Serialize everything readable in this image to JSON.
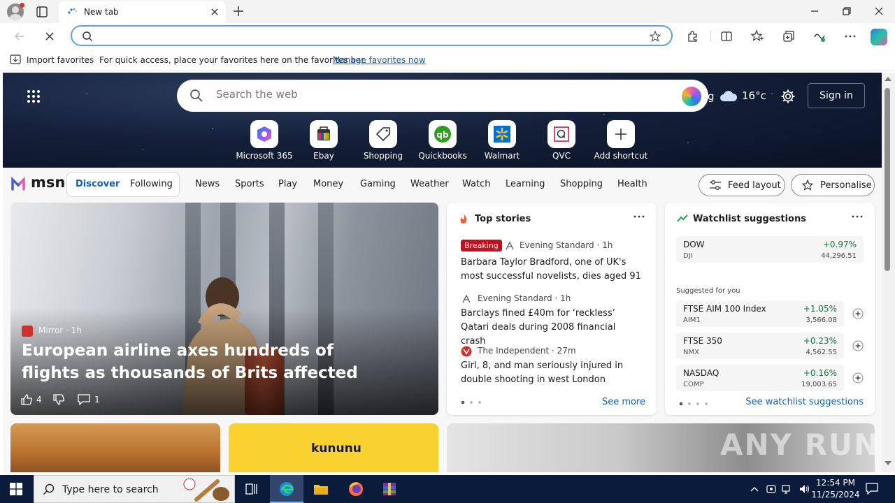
{
  "browser": {
    "tab_title": "New tab",
    "window_controls": [
      "minimize-icon",
      "restore-icon",
      "close-icon"
    ]
  },
  "toolbar": {
    "address_value": "",
    "icons": [
      "back-icon",
      "stop-loading-icon",
      "search-icon",
      "favorite-star-icon",
      "extensions-icon",
      "split-screen-icon",
      "favorites-icon",
      "collections-icon",
      "browser-essentials-icon",
      "more-icon",
      "copilot-icon"
    ]
  },
  "favbar": {
    "import_label": "Import favorites",
    "message": "For quick access, place your favorites here on the favorites bar.",
    "manage_link": "Manage favorites now"
  },
  "hero": {
    "search_placeholder": "Search the web",
    "bing_label": "g",
    "temperature": "16°c",
    "signin_label": "Sign in",
    "shortcuts": [
      {
        "label": "Microsoft 365",
        "icon": "microsoft-365-icon"
      },
      {
        "label": "Ebay",
        "icon": "ebay-icon"
      },
      {
        "label": "Shopping",
        "icon": "shopping-tag-icon"
      },
      {
        "label": "Quickbooks",
        "icon": "quickbooks-icon"
      },
      {
        "label": "Walmart",
        "icon": "walmart-icon"
      },
      {
        "label": "QVC",
        "icon": "qvc-icon"
      },
      {
        "label": "Add shortcut",
        "icon": "plus-icon"
      }
    ]
  },
  "msn": {
    "logo_text": "msn",
    "seg_discover": "Discover",
    "seg_following": "Following",
    "nav": [
      "News",
      "Sports",
      "Play",
      "Money",
      "Gaming",
      "Weather",
      "Watch",
      "Learning",
      "Shopping",
      "Health"
    ],
    "feed_layout_label": "Feed layout",
    "personalise_label": "Personalise"
  },
  "hero_story": {
    "source": "Mirror · 1h",
    "title": "European airline axes hundreds of flights as thousands of Brits affected",
    "likes": "4",
    "comments": "1"
  },
  "top_stories": {
    "title": "Top stories",
    "breaking_label": "Breaking",
    "items": [
      {
        "source": "Evening Standard · 1h",
        "headline": "Barbara Taylor Bradford, one of UK's most successful novelists, dies aged 91"
      },
      {
        "source": "Evening Standard · 1h",
        "headline": "Barclays fined £40m for ‘reckless’ Qatari deals during 2008 financial crash"
      },
      {
        "source": "The Independent · 27m",
        "headline": "Girl, 8, and man seriously injured in double shooting in west London"
      }
    ],
    "see_more": "See more"
  },
  "watchlist": {
    "title": "Watchlist suggestions",
    "main": {
      "name": "DOW",
      "symbol": "DJI",
      "change": "+0.97%",
      "price": "44,296.51"
    },
    "suggested_label": "Suggested for you",
    "items": [
      {
        "name": "FTSE AIM 100 Index",
        "symbol": "AIM1",
        "change": "+1.05%",
        "price": "3,566.08"
      },
      {
        "name": "FTSE 350",
        "symbol": "NMX",
        "change": "+0.23%",
        "price": "4,562.55"
      },
      {
        "name": "NASDAQ",
        "symbol": "COMP",
        "change": "+0.16%",
        "price": "19,003.65"
      }
    ],
    "see_link": "See watchlist suggestions"
  },
  "tiles": {
    "kununu_logo": "kununu",
    "watermark": "ANY RUN"
  },
  "taskbar": {
    "search_placeholder": "Type here to search",
    "time": "12:54 PM",
    "date": "11/25/2024"
  },
  "colors": {
    "accent": "#0f5fb8",
    "breaking": "#c50f1f",
    "positive": "#0b7a3e",
    "taskbar": "#0a1b3b"
  }
}
